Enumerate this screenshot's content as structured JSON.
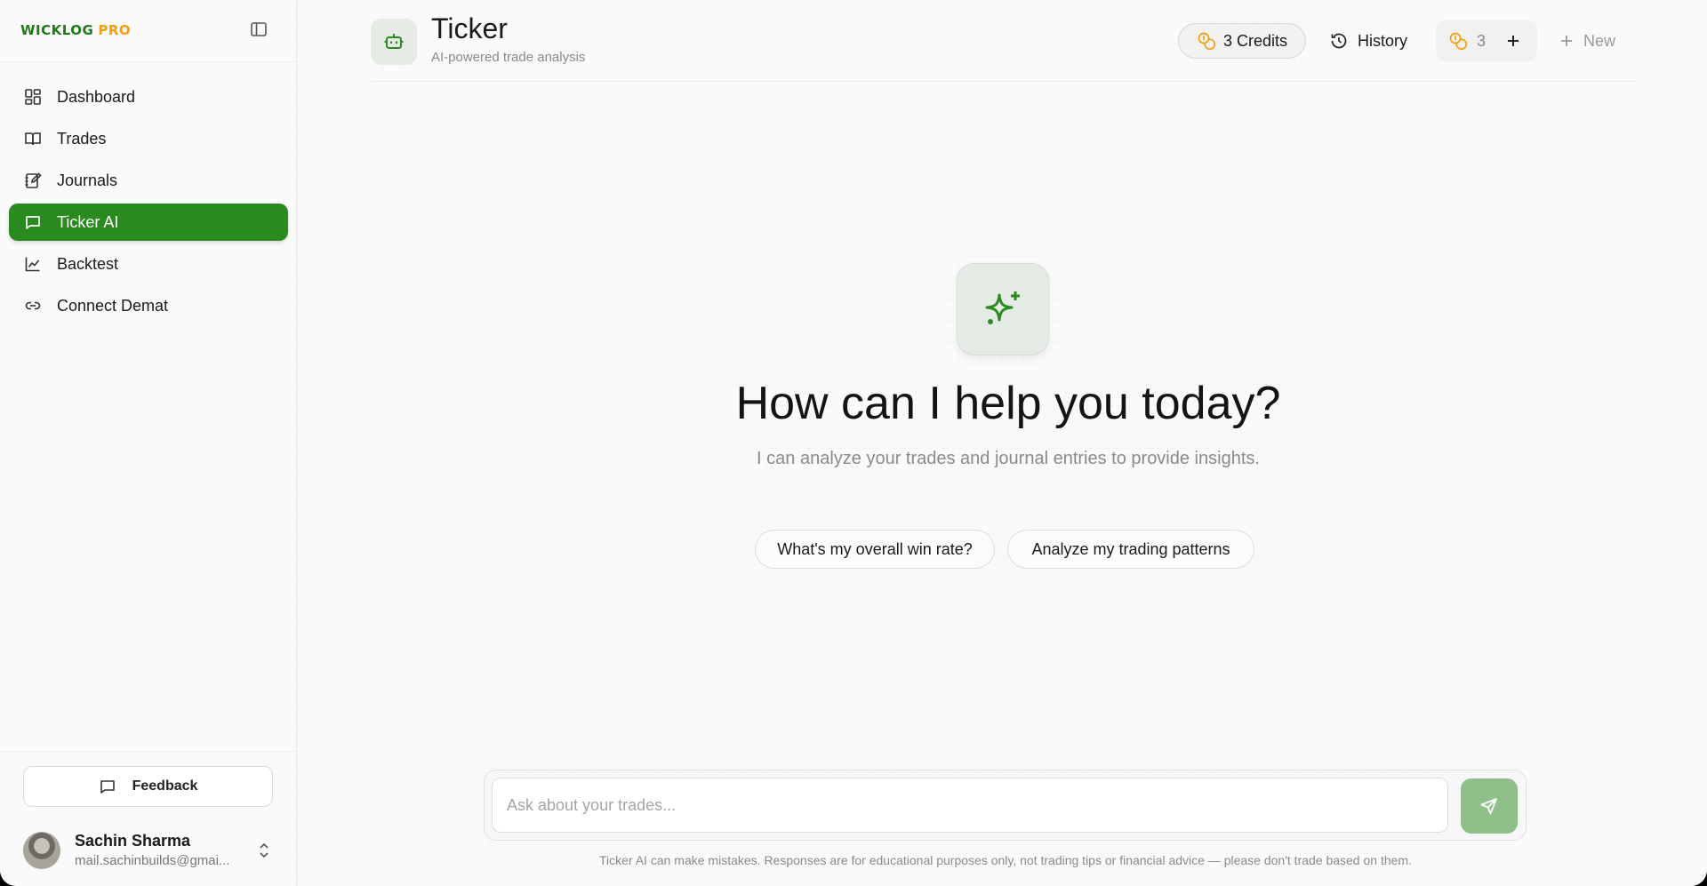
{
  "brand": {
    "name_primary": "WICKLOG",
    "name_secondary": "PRO",
    "primary_color": "#1f7a1a",
    "secondary_color": "#f59e0b"
  },
  "sidebar": {
    "items": [
      {
        "label": "Dashboard",
        "icon": "dashboard-icon",
        "active": false
      },
      {
        "label": "Trades",
        "icon": "book-icon",
        "active": false
      },
      {
        "label": "Journals",
        "icon": "journal-icon",
        "active": false
      },
      {
        "label": "Ticker AI",
        "icon": "chat-icon",
        "active": true
      },
      {
        "label": "Backtest",
        "icon": "chart-line-icon",
        "active": false
      },
      {
        "label": "Connect Demat",
        "icon": "link-icon",
        "active": false
      }
    ],
    "active_color": "#2a8a20",
    "feedback_label": "Feedback",
    "user": {
      "name": "Sachin Sharma",
      "email": "mail.sachinbuilds@gmai..."
    }
  },
  "header": {
    "title": "Ticker",
    "subtitle": "AI-powered trade analysis",
    "credits_label": "3 Credits",
    "history_label": "History",
    "credit_count": "3",
    "new_label": "New"
  },
  "hero": {
    "title": "How can I help you today?",
    "subtitle": "I can analyze your trades and journal entries to provide insights.",
    "suggestions": [
      "What's my overall win rate?",
      "Analyze my trading patterns"
    ]
  },
  "chat": {
    "placeholder": "Ask about your trades...",
    "send_color": "#8fc08a",
    "disclaimer": "Ticker AI can make mistakes. Responses are for educational purposes only, not trading tips or financial advice — please don't trade based on them."
  }
}
